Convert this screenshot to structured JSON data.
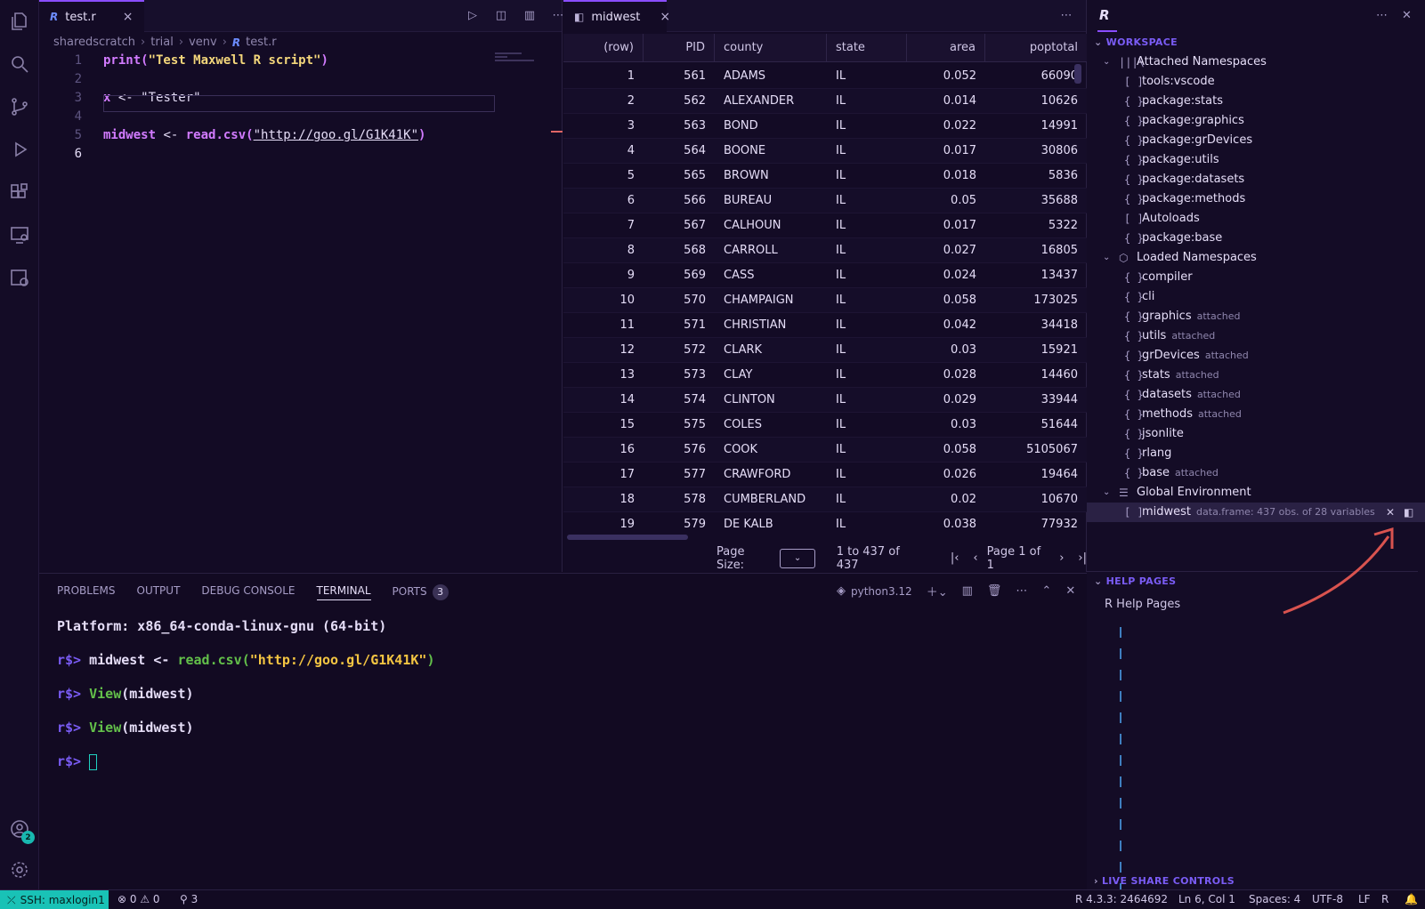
{
  "editor": {
    "tab_label": "test.r",
    "tab_close": "×",
    "breadcrumb": [
      "sharedscratch",
      "trial",
      "venv",
      "test.r"
    ],
    "lines": [
      {
        "n": "1"
      },
      {
        "n": "2"
      },
      {
        "n": "3"
      },
      {
        "n": "4"
      },
      {
        "n": "5"
      },
      {
        "n": "6"
      }
    ],
    "code": {
      "l1_fn": "print(",
      "l1_str": "\"Test Maxwell R script\"",
      "l1_end": ")",
      "l3_var": "x",
      "l3_op": " <- ",
      "l3_str": "\"Tester\"",
      "l5_var": "midwest",
      "l5_op": " <- ",
      "l5_fn": "read.csv(",
      "l5_str": "\"http://goo.gl/G1K41K\"",
      "l5_end": ")"
    }
  },
  "viewer": {
    "tab_label": "midwest",
    "tab_close": "×",
    "columns": [
      "(row)",
      "PID",
      "county",
      "state",
      "area",
      "poptotal"
    ],
    "rows": [
      [
        "1",
        "561",
        "ADAMS",
        "IL",
        "0.052",
        "66090"
      ],
      [
        "2",
        "562",
        "ALEXANDER",
        "IL",
        "0.014",
        "10626"
      ],
      [
        "3",
        "563",
        "BOND",
        "IL",
        "0.022",
        "14991"
      ],
      [
        "4",
        "564",
        "BOONE",
        "IL",
        "0.017",
        "30806"
      ],
      [
        "5",
        "565",
        "BROWN",
        "IL",
        "0.018",
        "5836"
      ],
      [
        "6",
        "566",
        "BUREAU",
        "IL",
        "0.05",
        "35688"
      ],
      [
        "7",
        "567",
        "CALHOUN",
        "IL",
        "0.017",
        "5322"
      ],
      [
        "8",
        "568",
        "CARROLL",
        "IL",
        "0.027",
        "16805"
      ],
      [
        "9",
        "569",
        "CASS",
        "IL",
        "0.024",
        "13437"
      ],
      [
        "10",
        "570",
        "CHAMPAIGN",
        "IL",
        "0.058",
        "173025"
      ],
      [
        "11",
        "571",
        "CHRISTIAN",
        "IL",
        "0.042",
        "34418"
      ],
      [
        "12",
        "572",
        "CLARK",
        "IL",
        "0.03",
        "15921"
      ],
      [
        "13",
        "573",
        "CLAY",
        "IL",
        "0.028",
        "14460"
      ],
      [
        "14",
        "574",
        "CLINTON",
        "IL",
        "0.029",
        "33944"
      ],
      [
        "15",
        "575",
        "COLES",
        "IL",
        "0.03",
        "51644"
      ],
      [
        "16",
        "576",
        "COOK",
        "IL",
        "0.058",
        "5105067"
      ],
      [
        "17",
        "577",
        "CRAWFORD",
        "IL",
        "0.026",
        "19464"
      ],
      [
        "18",
        "578",
        "CUMBERLAND",
        "IL",
        "0.02",
        "10670"
      ],
      [
        "19",
        "579",
        "DE KALB",
        "IL",
        "0.038",
        "77932"
      ]
    ],
    "page_size_label": "Page Size:",
    "range": "1 to 437 of 437",
    "page": "Page 1 of 1"
  },
  "sidebar": {
    "workspace": "WORKSPACE",
    "attached": "Attached Namespaces",
    "attached_items": [
      {
        "ico": "[ ]",
        "label": "tools:vscode"
      },
      {
        "ico": "{ }",
        "label": "package:stats"
      },
      {
        "ico": "{ }",
        "label": "package:graphics"
      },
      {
        "ico": "{ }",
        "label": "package:grDevices"
      },
      {
        "ico": "{ }",
        "label": "package:utils"
      },
      {
        "ico": "{ }",
        "label": "package:datasets"
      },
      {
        "ico": "{ }",
        "label": "package:methods"
      },
      {
        "ico": "[ ]",
        "label": "Autoloads"
      },
      {
        "ico": "{ }",
        "label": "package:base"
      }
    ],
    "loaded": "Loaded Namespaces",
    "loaded_items": [
      {
        "label": "compiler",
        "desc": ""
      },
      {
        "label": "cli",
        "desc": ""
      },
      {
        "label": "graphics",
        "desc": "attached"
      },
      {
        "label": "utils",
        "desc": "attached"
      },
      {
        "label": "grDevices",
        "desc": "attached"
      },
      {
        "label": "stats",
        "desc": "attached"
      },
      {
        "label": "datasets",
        "desc": "attached"
      },
      {
        "label": "methods",
        "desc": "attached"
      },
      {
        "label": "jsonlite",
        "desc": ""
      },
      {
        "label": "rlang",
        "desc": ""
      },
      {
        "label": "base",
        "desc": "attached"
      }
    ],
    "global": "Global Environment",
    "global_item": {
      "label": "midwest",
      "desc": "data.frame: 437 obs. of 28 variables"
    },
    "help": "HELP PAGES",
    "help_item": "R Help Pages",
    "live_share": "LIVE SHARE CONTROLS"
  },
  "panel": {
    "tabs": [
      "PROBLEMS",
      "OUTPUT",
      "DEBUG CONSOLE",
      "TERMINAL",
      "PORTS"
    ],
    "ports_count": "3",
    "shell": "python3.12",
    "platform": "Platform: x86_64-conda-linux-gnu (64-bit)",
    "prompt": "r$>",
    "cmd1_a": "midwest <- ",
    "cmd1_fn": "read.csv(",
    "cmd1_str": "\"http://goo.gl/G1K41K\"",
    "cmd1_end": ")",
    "cmd2_fn": "View",
    "cmd2_rest": "(midwest)"
  },
  "status": {
    "remote": "SSH: maxlogin1",
    "errors": "0",
    "warnings": "0",
    "ports": "3",
    "r_version": "R 4.3.3: 2464692",
    "position": "Ln 6, Col 1",
    "spaces": "Spaces: 4",
    "encoding": "UTF-8",
    "eol": "LF",
    "language": "R"
  },
  "activity": {
    "accounts_badge": "2"
  },
  "colors": {
    "accent": "#8a4dff",
    "remote_bg": "#19c2b6",
    "annotation_arrow": "#d9534f"
  }
}
